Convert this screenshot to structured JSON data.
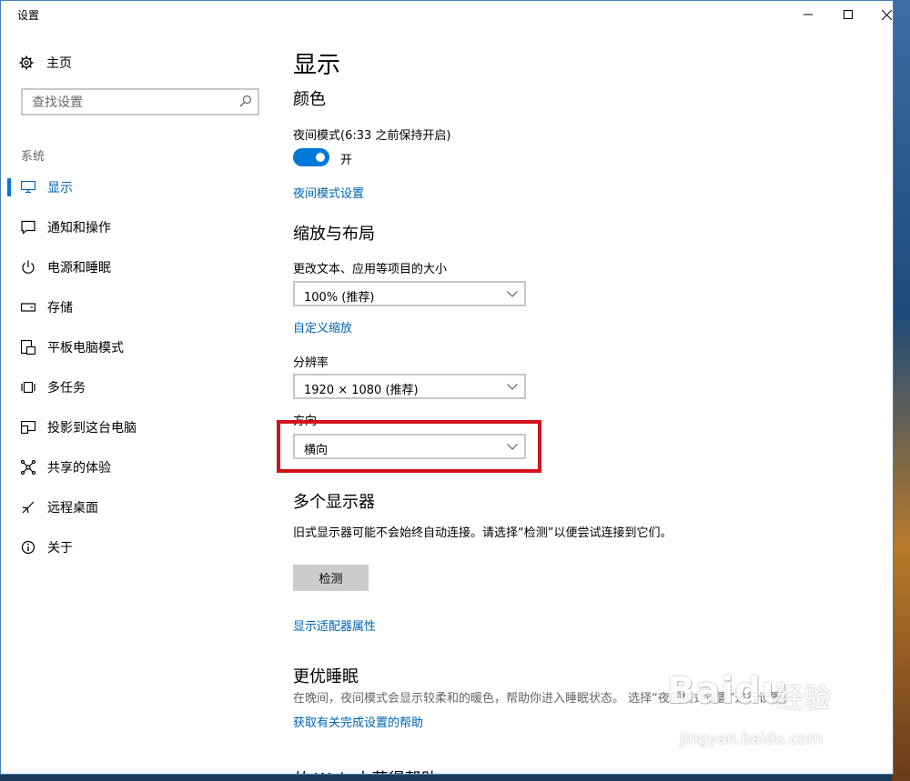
{
  "window": {
    "title": "设置"
  },
  "sidebar": {
    "home_label": "主页",
    "search_placeholder": "查找设置",
    "section_label": "系统",
    "items": [
      {
        "label": "显示",
        "icon": "monitor-icon",
        "active": true
      },
      {
        "label": "通知和操作",
        "icon": "notification-icon"
      },
      {
        "label": "电源和睡眠",
        "icon": "power-icon"
      },
      {
        "label": "存储",
        "icon": "storage-icon"
      },
      {
        "label": "平板电脑模式",
        "icon": "tablet-mode-icon"
      },
      {
        "label": "多任务",
        "icon": "multitasking-icon"
      },
      {
        "label": "投影到这台电脑",
        "icon": "project-icon"
      },
      {
        "label": "共享的体验",
        "icon": "shared-experiences-icon"
      },
      {
        "label": "远程桌面",
        "icon": "remote-desktop-icon"
      },
      {
        "label": "关于",
        "icon": "info-icon"
      }
    ]
  },
  "main": {
    "title": "显示",
    "color": {
      "heading": "颜色",
      "night_light_label": "夜间模式(6:33 之前保持开启)",
      "toggle_state": "开",
      "night_light_settings_link": "夜间模式设置"
    },
    "scale_layout": {
      "heading": "缩放与布局",
      "size_label": "更改文本、应用等项目的大小",
      "size_value": "100% (推荐)",
      "custom_scaling_link": "自定义缩放",
      "resolution_label": "分辨率",
      "resolution_value": "1920 × 1080 (推荐)",
      "orientation_label": "方向",
      "orientation_value": "横向"
    },
    "multiple_displays": {
      "heading": "多个显示器",
      "description": "旧式显示器可能不会始终自动连接。请选择“检测”以便尝试连接到它们。",
      "detect_button": "检测",
      "adapter_link": "显示适配器属性"
    },
    "sleep_better": {
      "heading": "更优睡眠",
      "description": "在晚间，夜间模式会显示较柔和的暖色，帮助你进入睡眠状态。 选择“夜间模式设置”进行设置。",
      "help_link": "获取有关完成设置的帮助"
    },
    "cutoff_heading": "从 Web 上获得帮助"
  },
  "watermark": {
    "logo": "Baidu",
    "cn": "经验",
    "url": "jingyan.baidu.com"
  },
  "colors": {
    "accent": "#0078d7",
    "link": "#0063b1",
    "highlight": "#d3111a"
  }
}
